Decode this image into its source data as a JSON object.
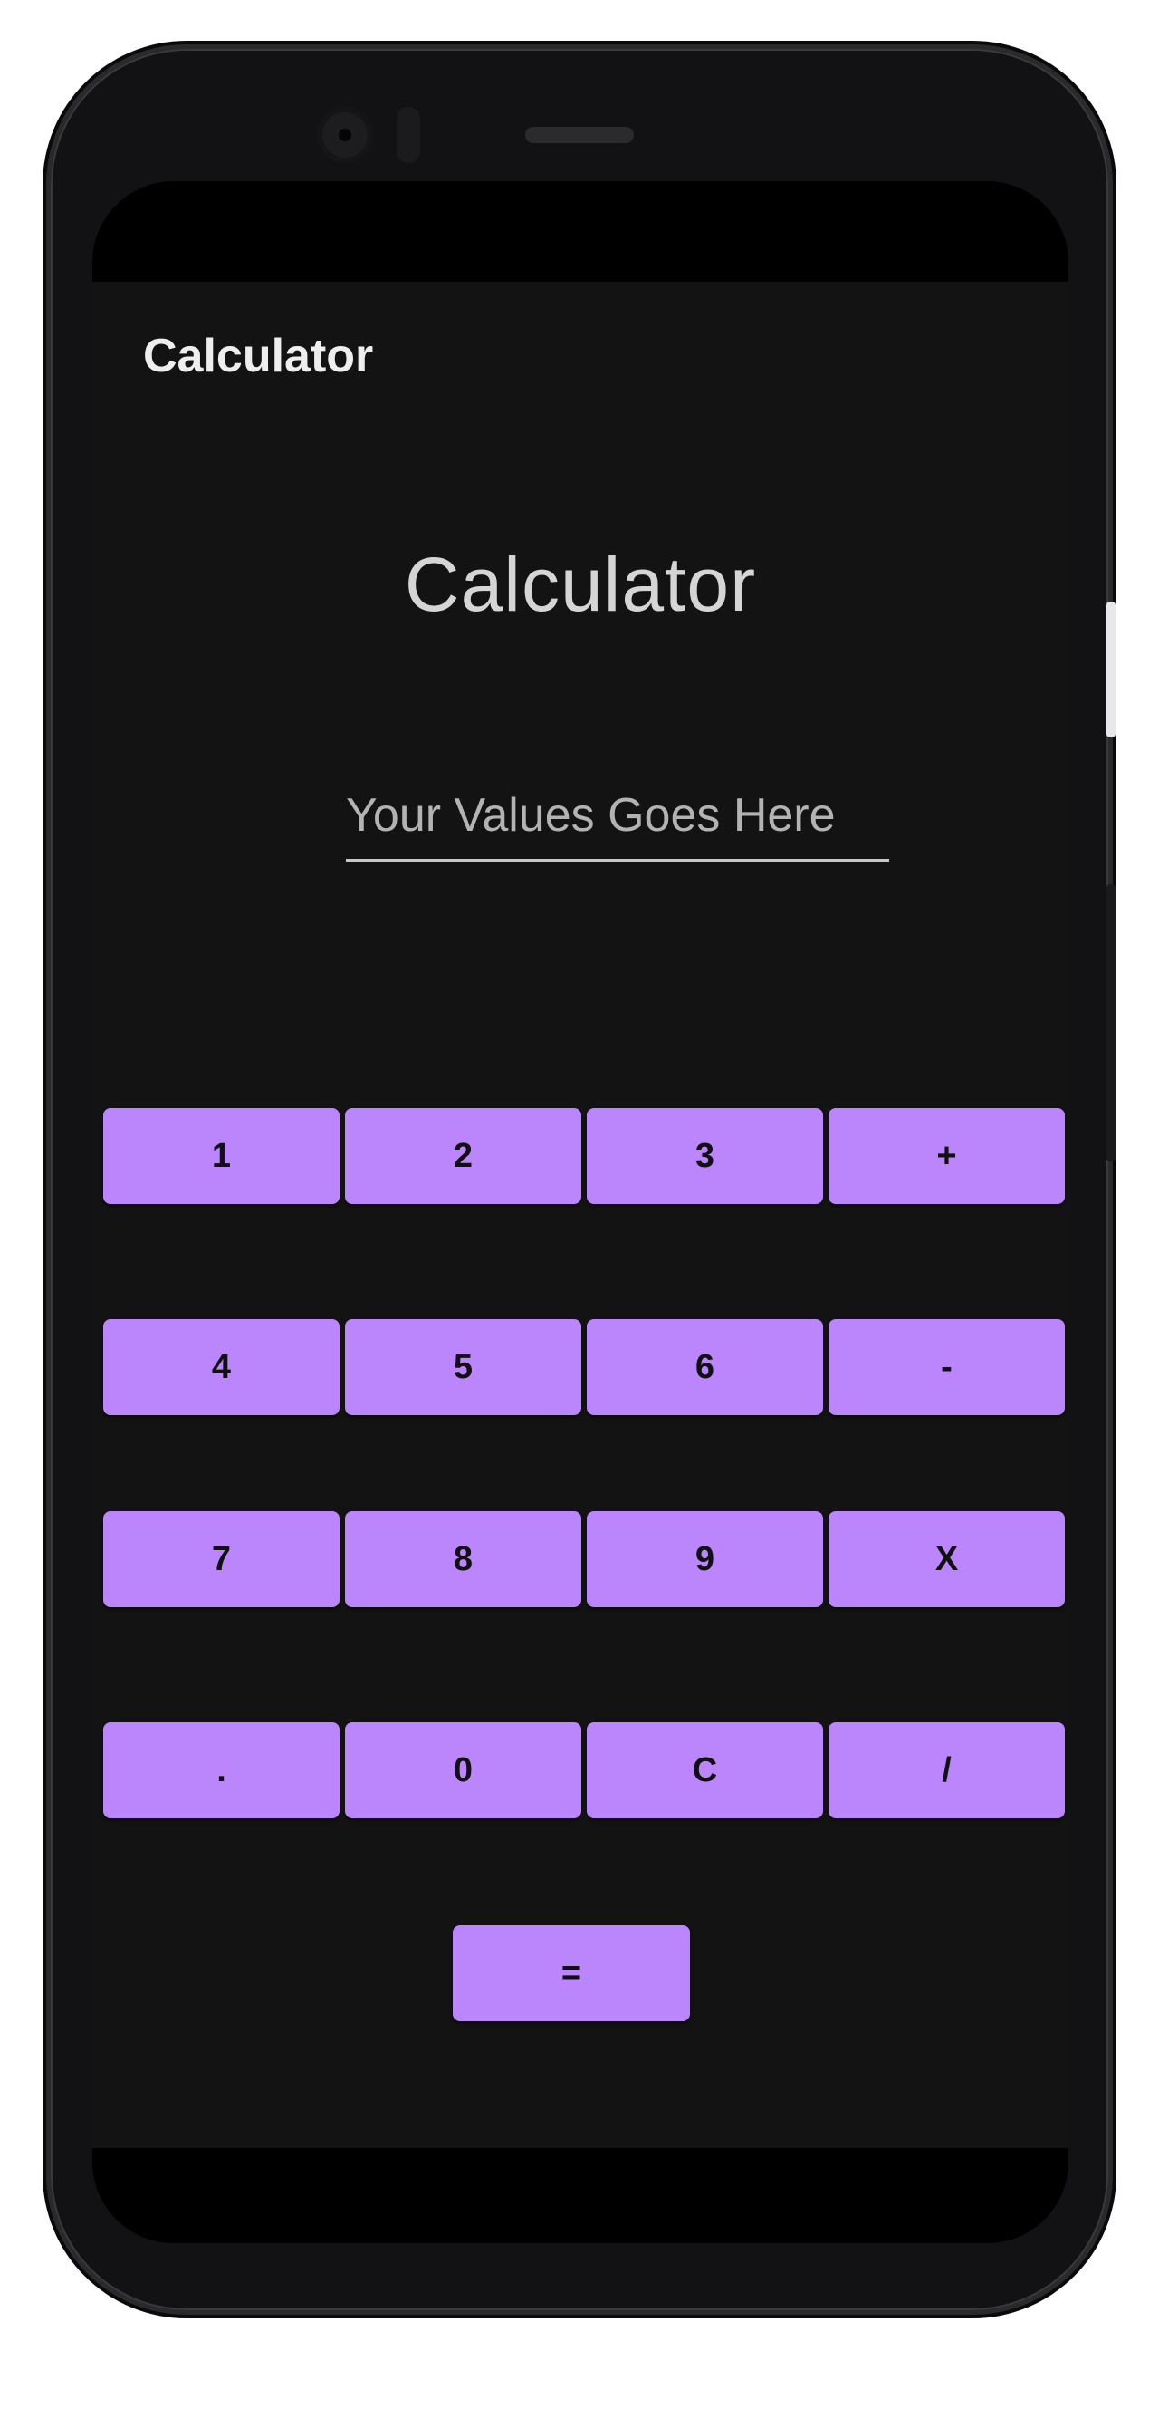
{
  "app": {
    "toolbar_title": "Calculator",
    "heading": "Calculator",
    "input": {
      "value": "",
      "placeholder": "Your Values Goes Here"
    }
  },
  "keypad": {
    "rows": [
      [
        "1",
        "2",
        "3",
        "+"
      ],
      [
        "4",
        "5",
        "6",
        "-"
      ],
      [
        "7",
        "8",
        "9",
        "X"
      ],
      [
        ".",
        "0",
        "C",
        "/"
      ]
    ],
    "equals": "="
  },
  "colors": {
    "accent": "#bb86fc",
    "background": "#131314",
    "text": "#eeeeee"
  }
}
